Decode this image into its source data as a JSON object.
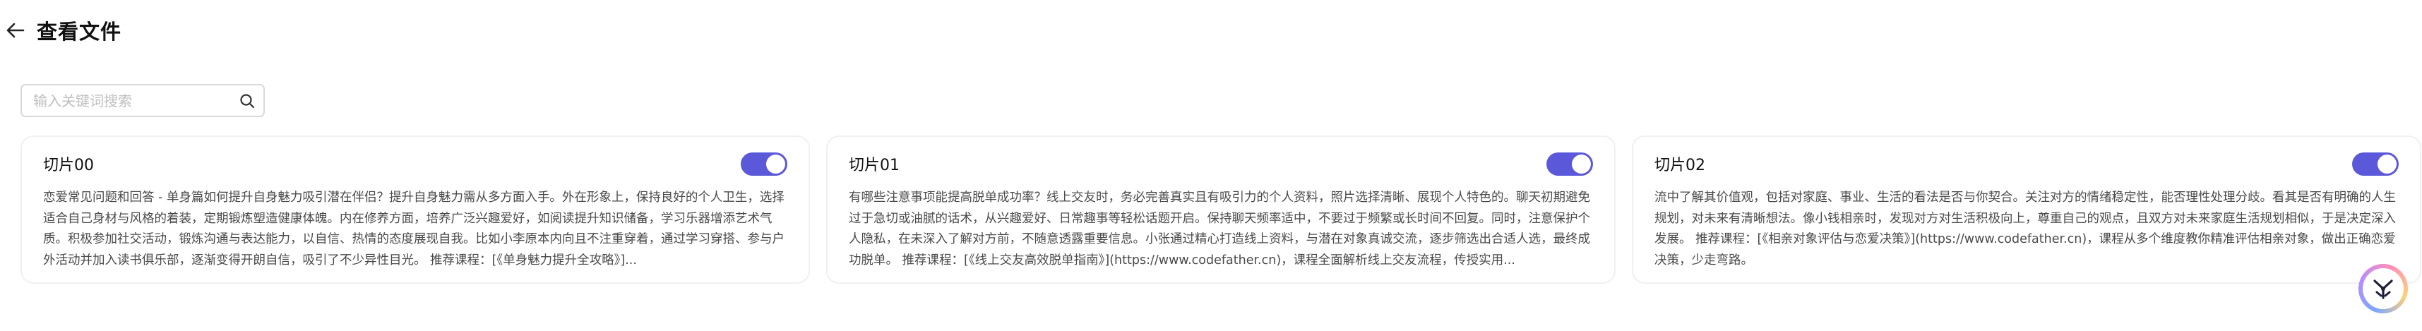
{
  "header": {
    "title": "查看文件",
    "back_icon": "arrow-left-icon"
  },
  "search": {
    "placeholder": "输入关键词搜索",
    "value": "",
    "icon": "search-icon"
  },
  "cards": [
    {
      "title": "切片00",
      "enabled": true,
      "content": "恋爱常见问题和回答 - 单身篇如何提升自身魅力吸引潜在伴侣？提升自身魅力需从多方面入手。外在形象上，保持良好的个人卫生，选择适合自己身材与风格的着装，定期锻炼塑造健康体魄。内在修养方面，培养广泛兴趣爱好，如阅读提升知识储备，学习乐器增添艺术气质。积极参加社交活动，锻炼沟通与表达能力，以自信、热情的态度展现自我。比如小李原本内向且不注重穿着，通过学习穿搭、参与户外活动并加入读书俱乐部，逐渐变得开朗自信，吸引了不少异性目光。 推荐课程：[《单身魅力提升全攻略》]..."
    },
    {
      "title": "切片01",
      "enabled": true,
      "content": "有哪些注意事项能提高脱单成功率？线上交友时，务必完善真实且有吸引力的个人资料，照片选择清晰、展现个人特色的。聊天初期避免过于急切或油腻的话术，从兴趣爱好、日常趣事等轻松话题开启。保持聊天频率适中，不要过于频繁或长时间不回复。同时，注意保护个人隐私，在未深入了解对方前，不随意透露重要信息。小张通过精心打造线上资料，与潜在对象真诚交流，逐步筛选出合适人选，最终成功脱单。 推荐课程：[《线上交友高效脱单指南》](https://www.codefather.cn)，课程全面解析线上交友流程，传授实用..."
    },
    {
      "title": "切片02",
      "enabled": true,
      "content": "流中了解其价值观，包括对家庭、事业、生活的看法是否与你契合。关注对方的情绪稳定性，能否理性处理分歧。看其是否有明确的人生规划，对未来有清晰想法。像小钱相亲时，发现对方对生活积极向上，尊重自己的观点，且双方对未来家庭生活规划相似，于是决定深入发展。 推荐课程：[《相亲对象评估与恋爱决策》](https://www.codefather.cn)，课程从多个维度教你精准评估相亲对象，做出正确恋爱决策，少走弯路。"
    }
  ],
  "fab": {
    "icon": "assistant-logo-icon"
  },
  "colors": {
    "accent": "#5b59d9",
    "card_border": "#f0f0f0",
    "text_body": "#4a4a4a"
  }
}
